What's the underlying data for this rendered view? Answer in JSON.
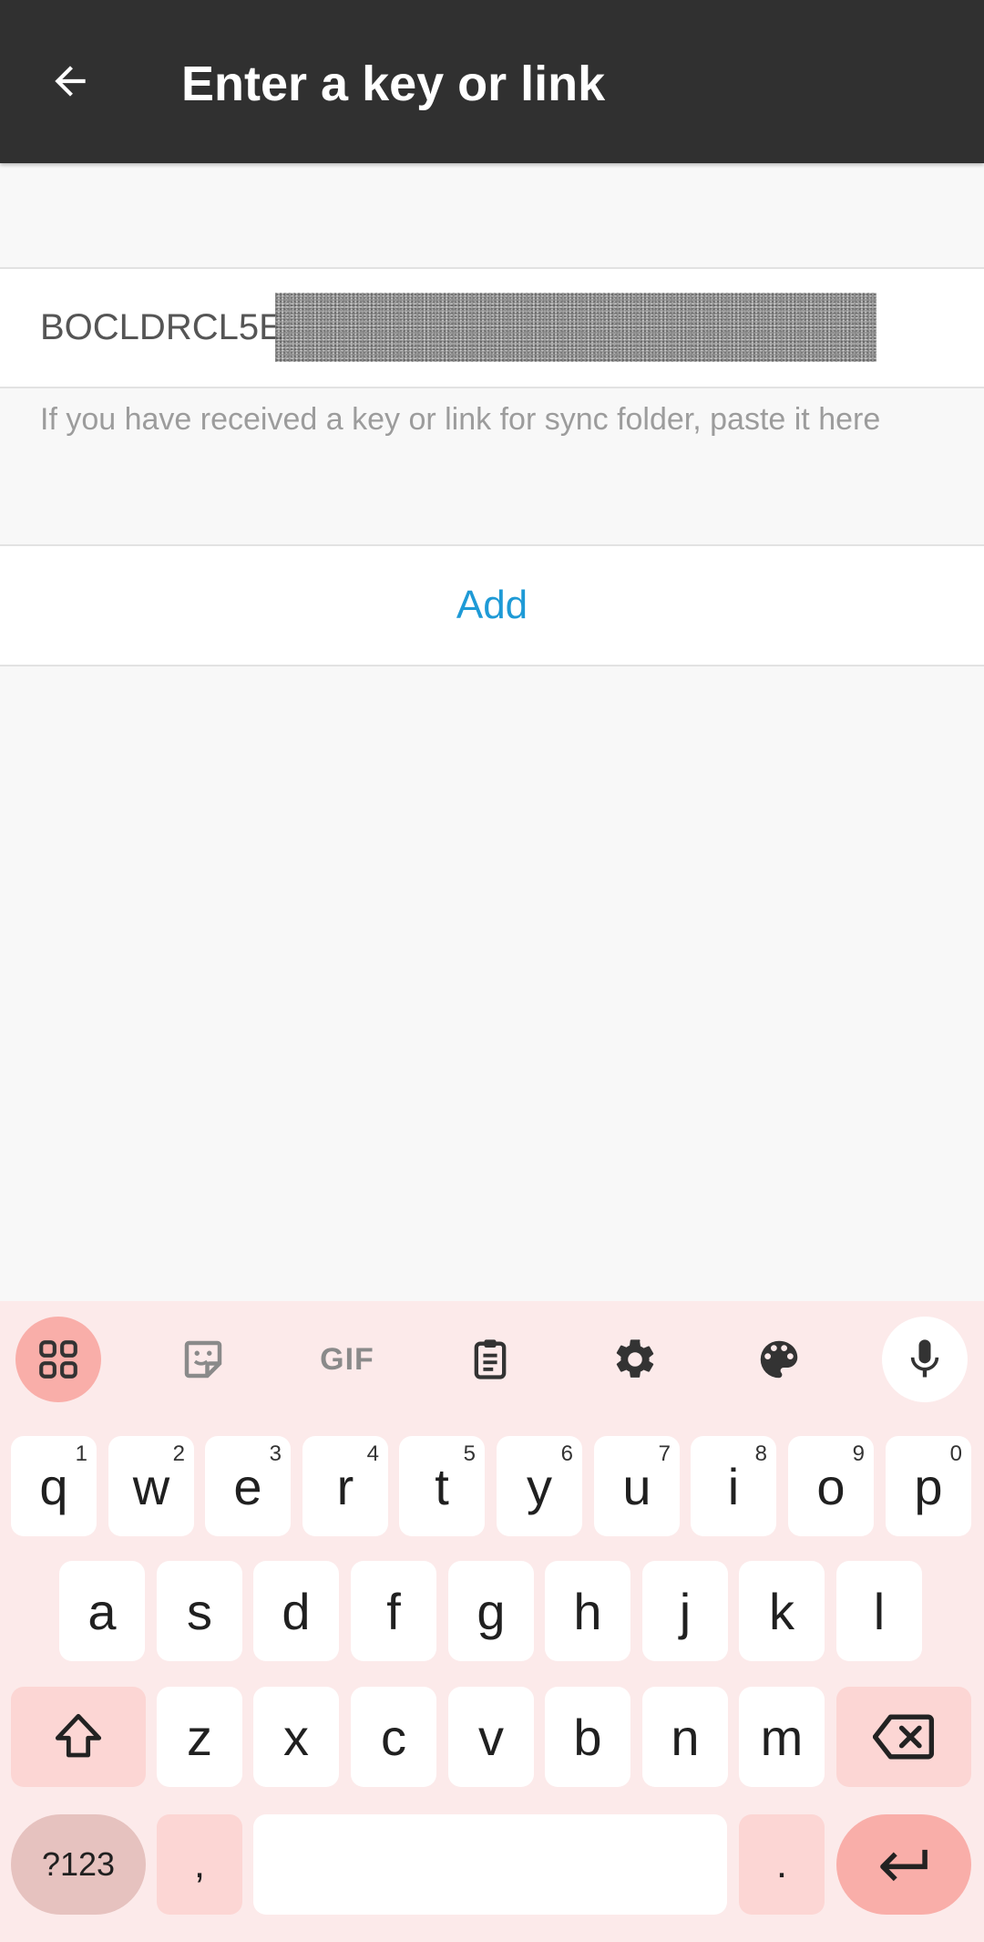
{
  "appbar": {
    "title": "Enter a key or link",
    "back_icon": "arrow-left-icon"
  },
  "form": {
    "key_value": "BOCLDRCL5E",
    "hint": "If you have received a key or link for sync folder, paste it here",
    "add_label": "Add"
  },
  "colors": {
    "appbar_bg": "#303030",
    "accent": "#1e9ad6",
    "keyboard_bg": "#fceaea",
    "key_special": "#fcd6d4"
  },
  "keyboard": {
    "toolbar": [
      "apps-grid-icon",
      "sticker-icon",
      "gif-icon",
      "clipboard-icon",
      "settings-gear-icon",
      "palette-icon",
      "microphone-icon"
    ],
    "gif_label": "GIF",
    "row1": [
      "q",
      "w",
      "e",
      "r",
      "t",
      "y",
      "u",
      "i",
      "o",
      "p"
    ],
    "row1_hints": [
      "1",
      "2",
      "3",
      "4",
      "5",
      "6",
      "7",
      "8",
      "9",
      "0"
    ],
    "row2": [
      "a",
      "s",
      "d",
      "f",
      "g",
      "h",
      "j",
      "k",
      "l"
    ],
    "row3": [
      "z",
      "x",
      "c",
      "v",
      "b",
      "n",
      "m"
    ],
    "symbols_label": "?123",
    "comma_label": ",",
    "period_label": "."
  }
}
